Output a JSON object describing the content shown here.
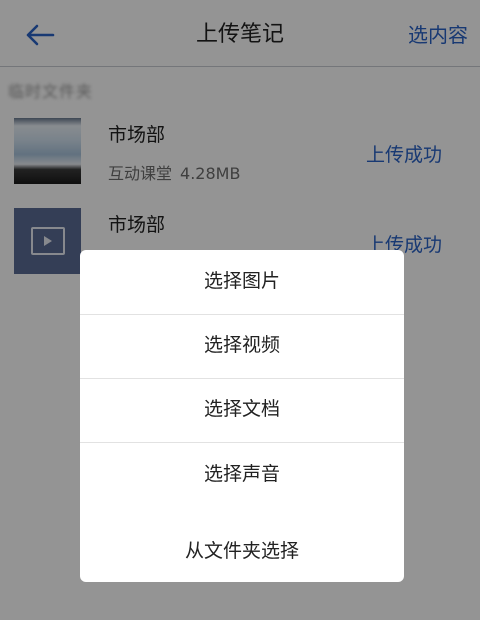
{
  "header": {
    "title": "上传笔记",
    "action_label": "选内容",
    "back_icon": "arrow-left-icon"
  },
  "list": {
    "section_label": "临时文件夹",
    "items": [
      {
        "title": "市场部",
        "type": "互动课堂",
        "size": "4.28MB",
        "status": "上传成功",
        "thumbnail": "image"
      },
      {
        "title": "市场部",
        "status": "上传成功",
        "thumbnail": "video-icon"
      }
    ]
  },
  "dialog": {
    "options": [
      "选择图片",
      "选择视频",
      "选择文档",
      "选择声音",
      "从文件夹选择"
    ]
  },
  "colors": {
    "accent": "#2a62c6",
    "overlay": "rgba(0,0,0,0.42)",
    "video_thumb": "#5b6b94"
  }
}
